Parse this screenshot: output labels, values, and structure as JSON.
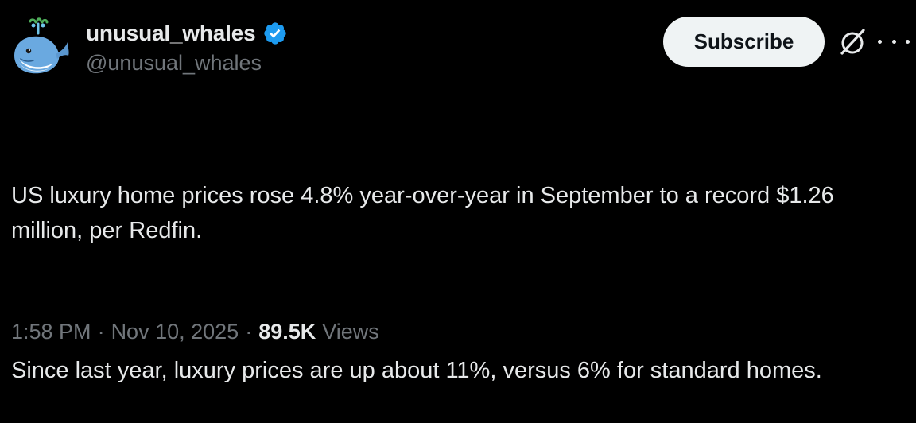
{
  "author": {
    "display_name": "unusual_whales",
    "handle": "@unusual_whales",
    "verified": true,
    "avatar_icon": "whale-icon"
  },
  "actions": {
    "subscribe_label": "Subscribe",
    "grok_icon": "grok-icon",
    "more_icon": "more-icon"
  },
  "tweet": {
    "paragraphs": [
      "US luxury home prices rose 4.8% year-over-year in September to a record $1.26 million, per Redfin.",
      "Since last year, luxury prices are up about 11%, versus 6% for standard homes."
    ]
  },
  "meta": {
    "time": "1:58 PM",
    "separator": "·",
    "date": "Nov 10, 2025",
    "views_count": "89.5K",
    "views_label": "Views"
  },
  "colors": {
    "background": "#000000",
    "primary_text": "#e7e9ea",
    "secondary_text": "#71767b",
    "verified_blue": "#1d9bf0",
    "button_bg": "#eff3f4"
  }
}
